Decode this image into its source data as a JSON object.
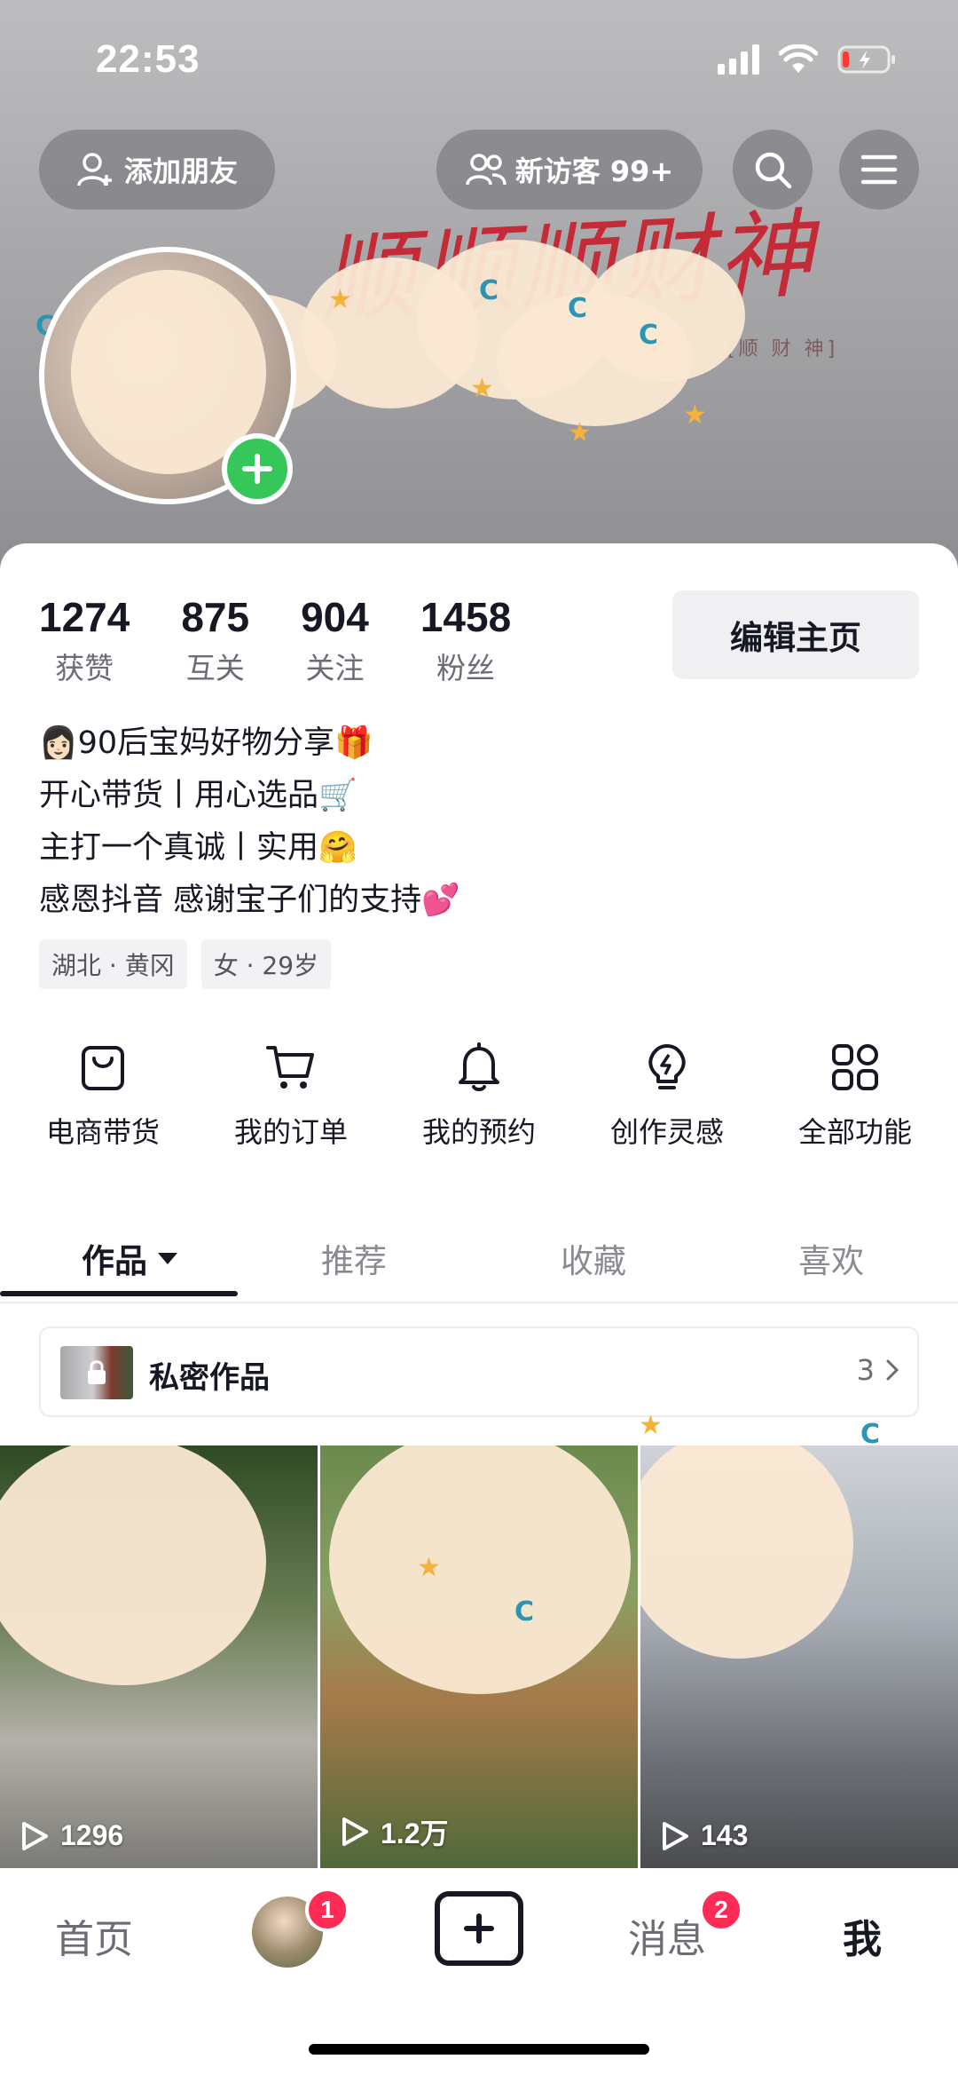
{
  "status_bar": {
    "time": "22:53"
  },
  "top_actions": {
    "add_friend": "添加朋友",
    "new_visitors": "新访客 99+"
  },
  "banner": {
    "text": "顺顺顺财神",
    "subtitle": "[顺 财 神]"
  },
  "stats": [
    {
      "value": "1274",
      "label": "获赞"
    },
    {
      "value": "875",
      "label": "互关"
    },
    {
      "value": "904",
      "label": "关注"
    },
    {
      "value": "1458",
      "label": "粉丝"
    }
  ],
  "edit_button": "编辑主页",
  "bio": [
    "👩🏻90后宝妈好物分享🎁",
    "开心带货丨用心选品🛒",
    "主打一个真诚丨实用🤗",
    "感恩抖音  感谢宝子们的支持💕"
  ],
  "tags": [
    "湖北 · 黄冈",
    "女 · 29岁"
  ],
  "features": [
    {
      "label": "电商带货",
      "icon": "bag-icon"
    },
    {
      "label": "我的订单",
      "icon": "cart-icon"
    },
    {
      "label": "我的预约",
      "icon": "bell-icon"
    },
    {
      "label": "创作灵感",
      "icon": "bulb-icon"
    },
    {
      "label": "全部功能",
      "icon": "grid-icon"
    }
  ],
  "tabs": [
    "作品",
    "推荐",
    "收藏",
    "喜欢"
  ],
  "private_works": {
    "label": "私密作品",
    "count": "3"
  },
  "videos": [
    {
      "plays": "1296"
    },
    {
      "plays": "1.2万"
    },
    {
      "plays": "143"
    }
  ],
  "bottom_nav": {
    "home": "首页",
    "friends_badge": "1",
    "messages": "消息",
    "messages_badge": "2",
    "me": "我"
  },
  "colors": {
    "accent_red": "#fe2c55",
    "online_green": "#35c759",
    "text_primary": "#161823",
    "text_secondary": "#6b6c74"
  }
}
